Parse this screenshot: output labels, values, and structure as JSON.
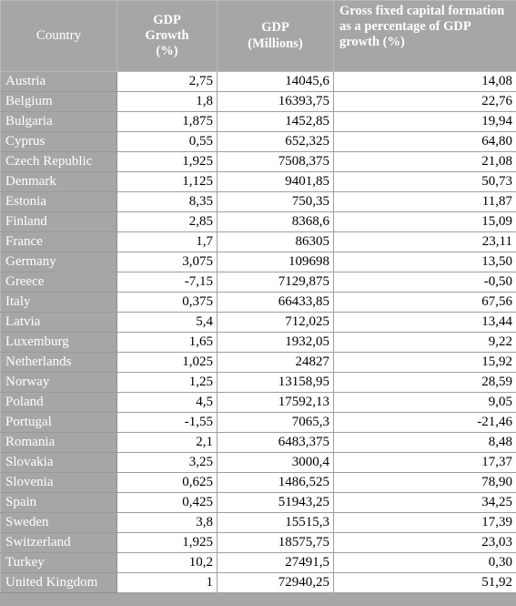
{
  "table": {
    "columns": [
      {
        "key": "country",
        "label": "Country",
        "align": "center",
        "bold": false
      },
      {
        "key": "gdp_growth",
        "label": "GDP\nGrowth\n(%)",
        "align": "center",
        "bold": true
      },
      {
        "key": "gdp_millions",
        "label": "GDP\n(Millions)",
        "align": "center",
        "bold": true
      },
      {
        "key": "gfcf_pct",
        "label": "Gross fixed capital formation as a percentage of GDP growth (%)",
        "align": "left",
        "bold": true
      }
    ],
    "rows": [
      {
        "country": "Austria",
        "gdp_growth": "2,75",
        "gdp_millions": "14045,6",
        "gfcf_pct": "14,08"
      },
      {
        "country": "Belgium",
        "gdp_growth": "1,8",
        "gdp_millions": "16393,75",
        "gfcf_pct": "22,76"
      },
      {
        "country": "Bulgaria",
        "gdp_growth": "1,875",
        "gdp_millions": "1452,85",
        "gfcf_pct": "19,94"
      },
      {
        "country": "Cyprus",
        "gdp_growth": "0,55",
        "gdp_millions": "652,325",
        "gfcf_pct": "64,80"
      },
      {
        "country": "Czech Republic",
        "gdp_growth": "1,925",
        "gdp_millions": "7508,375",
        "gfcf_pct": "21,08"
      },
      {
        "country": "Denmark",
        "gdp_growth": "1,125",
        "gdp_millions": "9401,85",
        "gfcf_pct": "50,73"
      },
      {
        "country": "Estonia",
        "gdp_growth": "8,35",
        "gdp_millions": "750,35",
        "gfcf_pct": "11,87"
      },
      {
        "country": "Finland",
        "gdp_growth": "2,85",
        "gdp_millions": "8368,6",
        "gfcf_pct": "15,09"
      },
      {
        "country": "France",
        "gdp_growth": "1,7",
        "gdp_millions": "86305",
        "gfcf_pct": "23,11"
      },
      {
        "country": "Germany",
        "gdp_growth": "3,075",
        "gdp_millions": "109698",
        "gfcf_pct": "13,50"
      },
      {
        "country": "Greece",
        "gdp_growth": "-7,15",
        "gdp_millions": "7129,875",
        "gfcf_pct": "-0,50"
      },
      {
        "country": "Italy",
        "gdp_growth": "0,375",
        "gdp_millions": "66433,85",
        "gfcf_pct": "67,56"
      },
      {
        "country": "Latvia",
        "gdp_growth": "5,4",
        "gdp_millions": "712,025",
        "gfcf_pct": "13,44"
      },
      {
        "country": "Luxemburg",
        "gdp_growth": "1,65",
        "gdp_millions": "1932,05",
        "gfcf_pct": "9,22"
      },
      {
        "country": "Netherlands",
        "gdp_growth": "1,025",
        "gdp_millions": "24827",
        "gfcf_pct": "15,92"
      },
      {
        "country": "Norway",
        "gdp_growth": "1,25",
        "gdp_millions": "13158,95",
        "gfcf_pct": "28,59"
      },
      {
        "country": "Poland",
        "gdp_growth": "4,5",
        "gdp_millions": "17592,13",
        "gfcf_pct": "9,05"
      },
      {
        "country": "Portugal",
        "gdp_growth": "-1,55",
        "gdp_millions": "7065,3",
        "gfcf_pct": "-21,46"
      },
      {
        "country": "Romania",
        "gdp_growth": "2,1",
        "gdp_millions": "6483,375",
        "gfcf_pct": "8,48"
      },
      {
        "country": "Slovakia",
        "gdp_growth": "3,25",
        "gdp_millions": "3000,4",
        "gfcf_pct": "17,37"
      },
      {
        "country": "Slovenia",
        "gdp_growth": "0,625",
        "gdp_millions": "1486,525",
        "gfcf_pct": "78,90"
      },
      {
        "country": "Spain",
        "gdp_growth": "0,425",
        "gdp_millions": "51943,25",
        "gfcf_pct": "34,25"
      },
      {
        "country": "Sweden",
        "gdp_growth": "3,8",
        "gdp_millions": "15515,3",
        "gfcf_pct": "17,39"
      },
      {
        "country": "Switzerland",
        "gdp_growth": "1,925",
        "gdp_millions": "18575,75",
        "gfcf_pct": "23,03"
      },
      {
        "country": "Turkey",
        "gdp_growth": "10,2",
        "gdp_millions": "27491,5",
        "gfcf_pct": "0,30"
      },
      {
        "country": "United Kingdom",
        "gdp_growth": "1",
        "gdp_millions": "72940,25",
        "gfcf_pct": "51,92"
      }
    ]
  },
  "colors": {
    "header_background": "#a6a6a6",
    "header_text": "#ffffff",
    "country_background": "#a6a6a6",
    "country_text": "#ffffff",
    "data_background": "#ffffff",
    "data_text": "#000000",
    "border": "#9e9e9e"
  }
}
